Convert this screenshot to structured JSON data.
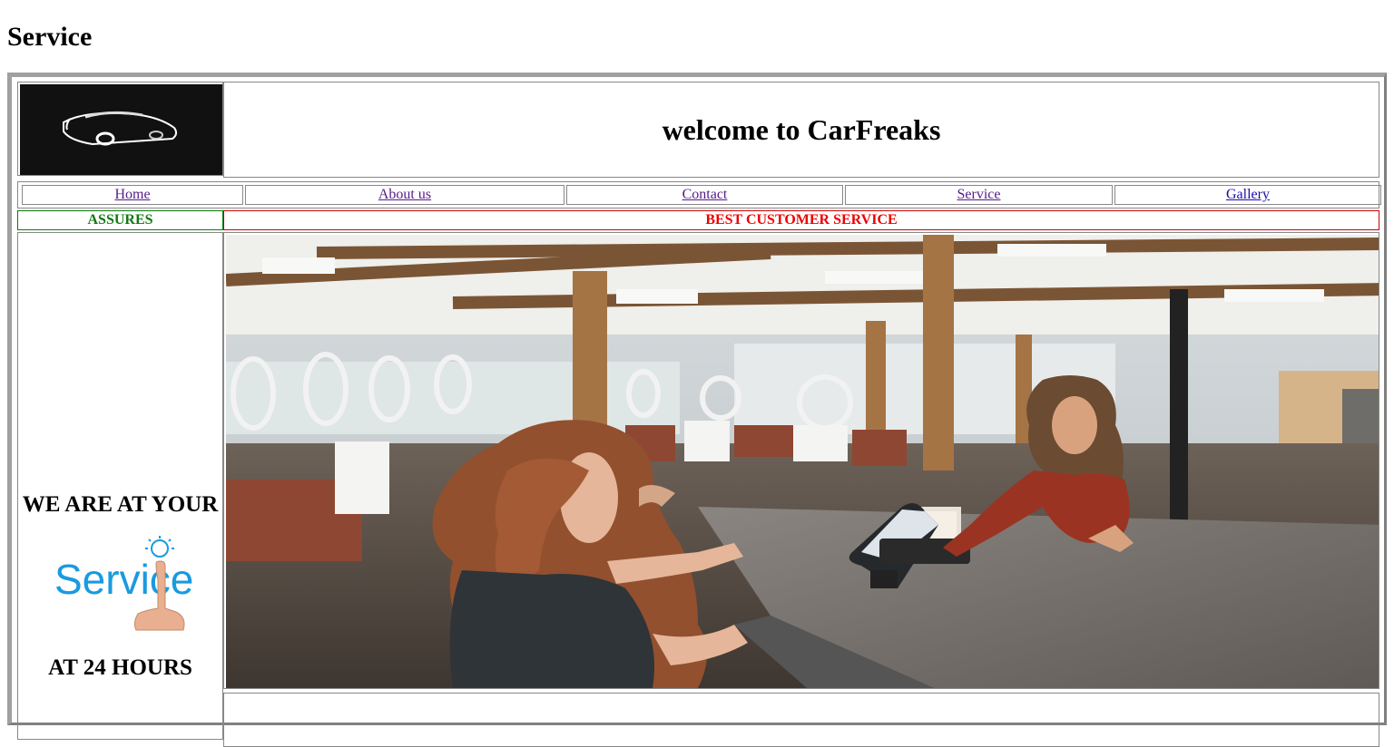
{
  "page": {
    "heading": "Service"
  },
  "header": {
    "welcome": "welcome to CarFreaks",
    "logo_icon": "car-logo-icon"
  },
  "nav": {
    "items": [
      {
        "label": "Home"
      },
      {
        "label": "About us"
      },
      {
        "label": "Contact"
      },
      {
        "label": "Service"
      },
      {
        "label": "Gallery"
      }
    ]
  },
  "banner": {
    "left_label": "ASSURES",
    "left_color": "#0f7a0f",
    "right_label": "BEST CUSTOMER SERVICE",
    "right_color": "#e00000"
  },
  "sidebar": {
    "line1": "WE ARE AT YOUR",
    "service_logo_text": "Service",
    "line2": "AT 24 HOURS",
    "service_logo_color": "#1a9ae0"
  },
  "main": {
    "photo_icon": "customer-service-photo"
  }
}
